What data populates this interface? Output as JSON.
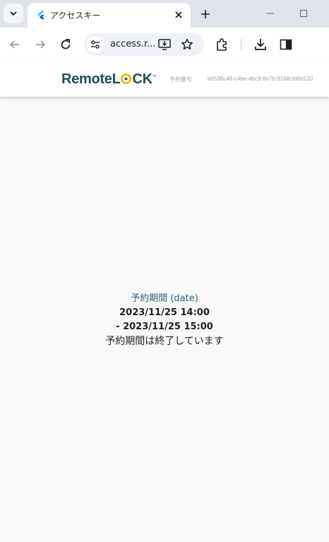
{
  "browser": {
    "tab_title": "アクセスキー",
    "url_display": "access.r...",
    "colors": {
      "tabbar": "#dfe3eb",
      "toolbar": "#ffffff",
      "omnibox": "#eef1f7"
    }
  },
  "app": {
    "logo_remote": "Remote",
    "logo_l": "L",
    "logo_ck": "CK",
    "logo_tm": "™",
    "booking_label": "予約番号",
    "booking_id": "b0538c48-c4be-4bc9-8e7b-9168cfd6d120",
    "colors": {
      "brand": "#1c4f5e",
      "accent": "#f2b705",
      "label": "#2a6478"
    }
  },
  "content": {
    "period_label": "予約期間 (date)",
    "start": "2023/11/25 14:00",
    "end": "- 2023/11/25 15:00",
    "status": "予約期間は終了しています"
  }
}
